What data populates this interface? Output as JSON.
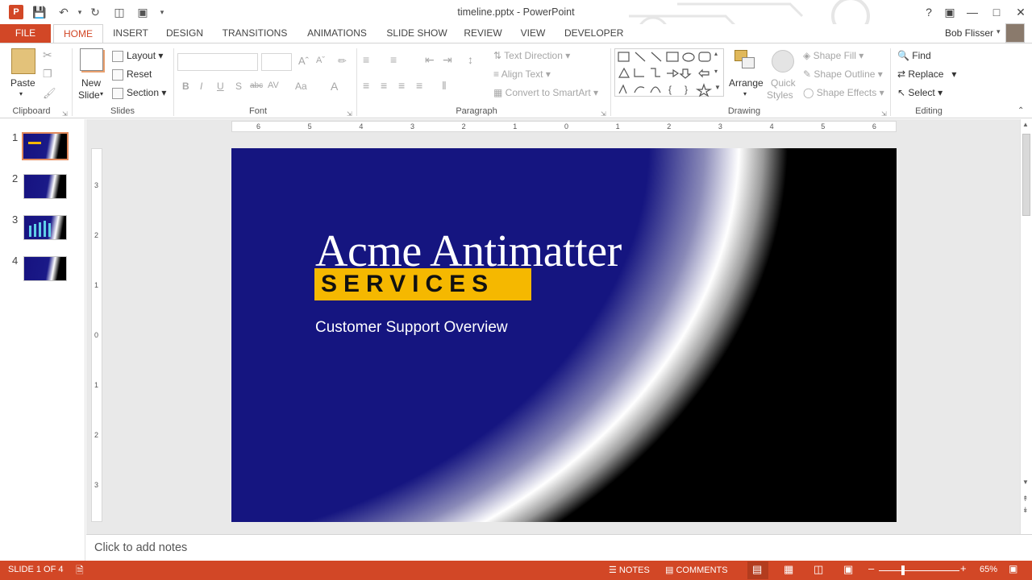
{
  "window": {
    "title": "timeline.pptx - PowerPoint",
    "user": "Bob Flisser"
  },
  "quick_access": [
    "powerpoint-logo-icon",
    "save-icon",
    "undo-icon",
    "redo-icon",
    "present-icon",
    "slideshow-icon",
    "customize-icon"
  ],
  "tabs": [
    {
      "label": "FILE"
    },
    {
      "label": "HOME"
    },
    {
      "label": "INSERT"
    },
    {
      "label": "DESIGN"
    },
    {
      "label": "TRANSITIONS"
    },
    {
      "label": "ANIMATIONS"
    },
    {
      "label": "SLIDE SHOW"
    },
    {
      "label": "REVIEW"
    },
    {
      "label": "VIEW"
    },
    {
      "label": "DEVELOPER"
    }
  ],
  "ribbon": {
    "clipboard": {
      "label": "Clipboard",
      "paste": "Paste"
    },
    "slides": {
      "label": "Slides",
      "new_slide_1": "New",
      "new_slide_2": "Slide",
      "layout": "Layout",
      "reset": "Reset",
      "section": "Section"
    },
    "font": {
      "label": "Font",
      "buttons": [
        "B",
        "I",
        "U",
        "S",
        "abc",
        "AV",
        "Aa",
        "A"
      ]
    },
    "paragraph": {
      "label": "Paragraph",
      "text_direction": "Text Direction",
      "align_text": "Align Text",
      "convert": "Convert to SmartArt"
    },
    "drawing": {
      "label": "Drawing",
      "arrange": "Arrange",
      "quick_1": "Quick",
      "quick_2": "Styles",
      "shape_fill": "Shape Fill",
      "shape_outline": "Shape Outline",
      "shape_effects": "Shape Effects"
    },
    "editing": {
      "label": "Editing",
      "find": "Find",
      "replace": "Replace",
      "select": "Select"
    }
  },
  "thumbnails": [
    {
      "num": "1"
    },
    {
      "num": "2"
    },
    {
      "num": "3"
    },
    {
      "num": "4"
    }
  ],
  "ruler": {
    "h_labels": [
      "6",
      "5",
      "4",
      "3",
      "2",
      "1",
      "0",
      "1",
      "2",
      "3",
      "4",
      "5",
      "6"
    ],
    "v_labels": [
      "3",
      "2",
      "1",
      "0",
      "1",
      "2",
      "3"
    ]
  },
  "slide": {
    "title": "Acme Antimatter",
    "services": "SERVICES",
    "subtitle": "Customer Support Overview",
    "colors": {
      "background": "#151580",
      "accent": "#f5b800"
    }
  },
  "notes": {
    "placeholder": "Click to add notes"
  },
  "status": {
    "slide_info": "SLIDE 1 OF 4",
    "notes": "NOTES",
    "comments": "COMMENTS",
    "zoom": "65%",
    "accent": "#d24726"
  }
}
